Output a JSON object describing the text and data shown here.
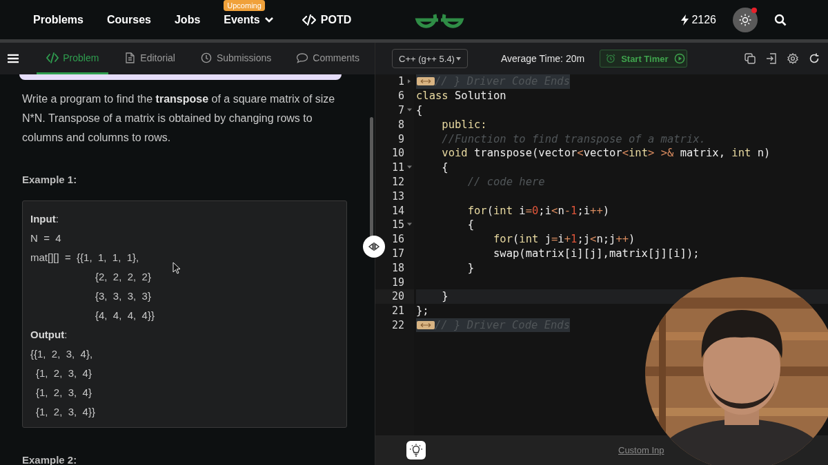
{
  "nav": {
    "items": [
      {
        "label": "Problems",
        "kind": "link"
      },
      {
        "label": "Courses",
        "kind": "link"
      },
      {
        "label": "Jobs",
        "kind": "link"
      },
      {
        "label": "Events",
        "kind": "dropdown",
        "badge": "Upcoming"
      },
      {
        "label": "POTD",
        "kind": "code"
      }
    ],
    "streak": "2126",
    "theme_notification": true
  },
  "tabs": [
    {
      "label": "Problem",
      "kind": "code",
      "selected": true
    },
    {
      "label": "Editorial",
      "kind": "doc",
      "selected": false
    },
    {
      "label": "Submissions",
      "kind": "clock",
      "selected": false
    },
    {
      "label": "Comments",
      "kind": "chat",
      "selected": false
    }
  ],
  "problem": {
    "statement": "Write a program to find the **transpose** of a square matrix of size N*N. Transpose of a matrix is obtained by changing rows to columns and columns to rows.",
    "examples": [
      {
        "title": "Example 1:",
        "lines": [
          {
            "text": "**Input**:",
            "kind": "plain"
          },
          {
            "text": "N  =  4",
            "kind": "plain"
          },
          {
            "text": "mat[][]  =  {{1,  1,  1,  1},",
            "kind": "plain"
          },
          {
            "text": "{2,  2,  2,  2}",
            "kind": "cont"
          },
          {
            "text": "{3,  3,  3,  3}",
            "kind": "cont"
          },
          {
            "text": "{4,  4,  4,  4}}",
            "kind": "cont"
          },
          {
            "text": "**Output**:",
            "kind": "plain"
          },
          {
            "text": "{{1,  2,  3,  4},",
            "kind": "plain"
          },
          {
            "text": "{1,  2,  3,  4}",
            "kind": "sub"
          },
          {
            "text": "{1,  2,  3,  4}",
            "kind": "sub"
          },
          {
            "text": "{1,  2,  3,  4}}",
            "kind": "sub"
          }
        ]
      },
      {
        "title": "Example 2:"
      }
    ]
  },
  "editor": {
    "language": "C++ (g++ 5.4)",
    "average_time": "Average Time: 20m",
    "timer_button": "Start Timer",
    "lines": [
      {
        "number": "1",
        "kind": "fold_closed",
        "active": false,
        "folded": true,
        "tokens": [
          {
            "text": "// } Driver Code Ends",
            "kind": "comment"
          }
        ]
      },
      {
        "number": "6",
        "kind": "code",
        "active": false,
        "folded": false,
        "tokens": [
          {
            "text": "class",
            "kind": "keyword"
          },
          {
            "text": " Solution",
            "kind": "plain"
          }
        ]
      },
      {
        "number": "7",
        "kind": "fold_start",
        "active": false,
        "folded": false,
        "tokens": [
          {
            "text": "{",
            "kind": "plain"
          }
        ]
      },
      {
        "number": "8",
        "kind": "code",
        "active": false,
        "folded": false,
        "tokens": [
          {
            "text": "    public:",
            "kind": "keyword"
          }
        ]
      },
      {
        "number": "9",
        "kind": "code",
        "active": false,
        "folded": false,
        "tokens": [
          {
            "text": "    //Function to find transpose of a matrix.",
            "kind": "comment"
          }
        ]
      },
      {
        "number": "10",
        "kind": "code",
        "active": false,
        "folded": false,
        "tokens": [
          {
            "text": "    void",
            "kind": "keyword"
          },
          {
            "text": " transpose(vector",
            "kind": "plain"
          },
          {
            "text": "<",
            "kind": "operator"
          },
          {
            "text": "vector",
            "kind": "plain"
          },
          {
            "text": "<",
            "kind": "operator"
          },
          {
            "text": "int",
            "kind": "keyword"
          },
          {
            "text": ">",
            "kind": "operator"
          },
          {
            "text": " >&",
            "kind": "operator"
          },
          {
            "text": " matrix, ",
            "kind": "plain"
          },
          {
            "text": "int",
            "kind": "keyword"
          },
          {
            "text": " n)",
            "kind": "plain"
          }
        ]
      },
      {
        "number": "11",
        "kind": "fold_start",
        "active": false,
        "folded": false,
        "tokens": [
          {
            "text": "    {",
            "kind": "plain"
          }
        ]
      },
      {
        "number": "12",
        "kind": "code",
        "active": false,
        "folded": false,
        "tokens": [
          {
            "text": "        // code here",
            "kind": "comment"
          }
        ]
      },
      {
        "number": "13",
        "kind": "code",
        "active": false,
        "folded": false
      },
      {
        "number": "14",
        "kind": "code",
        "active": false,
        "folded": false,
        "tokens": [
          {
            "text": "        for",
            "kind": "keyword"
          },
          {
            "text": "(",
            "kind": "plain"
          },
          {
            "text": "int",
            "kind": "keyword"
          },
          {
            "text": " i",
            "kind": "plain"
          },
          {
            "text": "=",
            "kind": "operator"
          },
          {
            "text": "0",
            "kind": "number"
          },
          {
            "text": ";i",
            "kind": "plain"
          },
          {
            "text": "<",
            "kind": "operator"
          },
          {
            "text": "n",
            "kind": "plain"
          },
          {
            "text": "-",
            "kind": "operator"
          },
          {
            "text": "1",
            "kind": "number"
          },
          {
            "text": ";i",
            "kind": "plain"
          },
          {
            "text": "++",
            "kind": "operator"
          },
          {
            "text": ")",
            "kind": "plain"
          }
        ]
      },
      {
        "number": "15",
        "kind": "fold_start",
        "active": false,
        "folded": false,
        "tokens": [
          {
            "text": "        {",
            "kind": "plain"
          }
        ]
      },
      {
        "number": "16",
        "kind": "code",
        "active": false,
        "folded": false,
        "tokens": [
          {
            "text": "            for",
            "kind": "keyword"
          },
          {
            "text": "(",
            "kind": "plain"
          },
          {
            "text": "int",
            "kind": "keyword"
          },
          {
            "text": " j",
            "kind": "plain"
          },
          {
            "text": "=",
            "kind": "operator"
          },
          {
            "text": "i",
            "kind": "plain"
          },
          {
            "text": "+",
            "kind": "operator"
          },
          {
            "text": "1",
            "kind": "number"
          },
          {
            "text": ";j",
            "kind": "plain"
          },
          {
            "text": "<",
            "kind": "operator"
          },
          {
            "text": "n;j",
            "kind": "plain"
          },
          {
            "text": "++",
            "kind": "operator"
          },
          {
            "text": ")",
            "kind": "plain"
          }
        ]
      },
      {
        "number": "17",
        "kind": "code",
        "active": false,
        "folded": false,
        "tokens": [
          {
            "text": "            swap(matrix[i][j],matrix[j][i]);",
            "kind": "plain"
          }
        ]
      },
      {
        "number": "18",
        "kind": "code",
        "active": false,
        "folded": false,
        "tokens": [
          {
            "text": "        }",
            "kind": "plain"
          }
        ]
      },
      {
        "number": "19",
        "kind": "code",
        "active": false,
        "folded": false
      },
      {
        "number": "20",
        "kind": "code",
        "active": true,
        "folded": false,
        "tokens": [
          {
            "text": "    }",
            "kind": "plain"
          }
        ]
      },
      {
        "number": "21",
        "kind": "code",
        "active": false,
        "folded": false,
        "tokens": [
          {
            "text": "};",
            "kind": "plain"
          }
        ]
      },
      {
        "number": "22",
        "kind": "code",
        "active": false,
        "folded": true,
        "tokens": [
          {
            "text": "// } Driver Code Ends",
            "kind": "comment"
          }
        ]
      }
    ],
    "custom_input": "Custom Inp"
  }
}
